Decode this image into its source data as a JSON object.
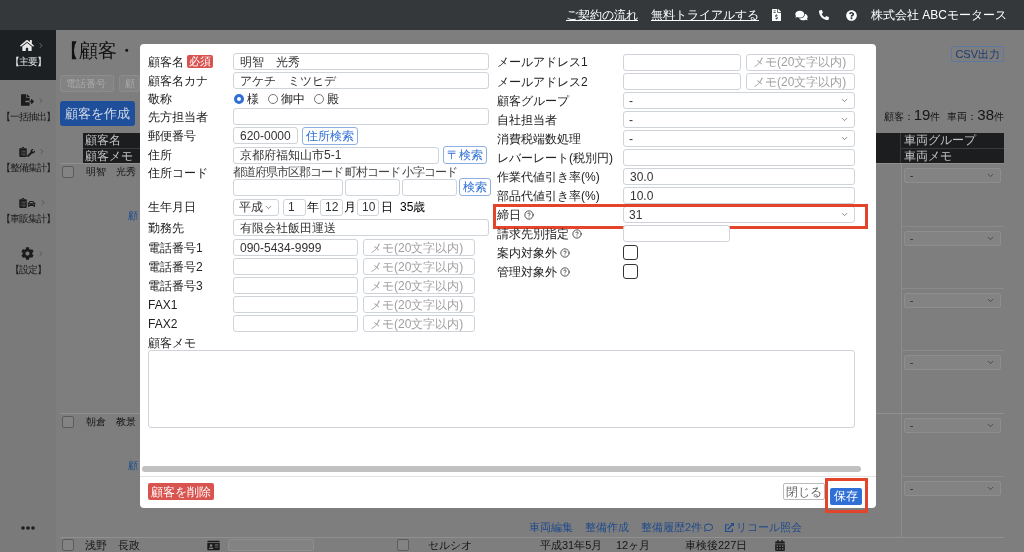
{
  "header": {
    "links": [
      "ご契約の流れ",
      "無料トライアルする"
    ],
    "company": "株式会社 ABCモータース"
  },
  "sidebar": {
    "items": [
      {
        "label": "【主要】",
        "selected": true
      },
      {
        "label": "【一括抽出】",
        "selected": false
      },
      {
        "label": "【整備集計】",
        "selected": false
      },
      {
        "label": "【車販集計】",
        "selected": false
      },
      {
        "label": "【設定】",
        "selected": false
      }
    ]
  },
  "page": {
    "title": "【顧客・",
    "filters": [
      {
        "placeholder": "電話番号"
      },
      {
        "placeholder": "顧"
      }
    ],
    "create_button": "顧客を作成",
    "csv_button": "CSV出力",
    "counts": [
      {
        "label": "顧客：",
        "value": "19",
        "unit": "件"
      },
      {
        "label": "車両：",
        "value": "38",
        "unit": "件"
      }
    ]
  },
  "table": {
    "left_header": [
      "顧客名",
      "顧客メモ"
    ],
    "right_header": [
      "車両グループ",
      "車両メモ"
    ],
    "rows": [
      {
        "checked": false,
        "name": "明智　光秀",
        "link": "顧",
        "vehicles": [
          {
            "group": "-"
          },
          {
            "group": "-"
          },
          {
            "group": "-"
          },
          {
            "group": "-"
          }
        ]
      },
      {
        "checked": false,
        "name": "朝倉　教景",
        "link": "顧",
        "vehicles": [
          {
            "group": "-"
          },
          {
            "group": "-"
          }
        ],
        "actions": [
          {
            "kind": "plain",
            "label": "車両編集"
          },
          {
            "kind": "plain",
            "label": "整備作成"
          },
          {
            "kind": "comments",
            "label": "整備履歴2件"
          },
          {
            "kind": "external",
            "label": "リコール照会"
          }
        ]
      },
      {
        "checked": false,
        "name": "浅野　長政",
        "vehicle": {
          "checked": false,
          "model": "セルシオ",
          "first_registered": "平成31年5月",
          "interval": "12ヶ月",
          "inspection": "車検後227日"
        }
      }
    ]
  },
  "modal": {
    "left_fields": [
      {
        "kind": "text",
        "label": "顧客名",
        "badge": "必須",
        "value": "明智　光秀"
      },
      {
        "kind": "text",
        "label": "顧客名カナ",
        "value": "アケチ　ミツヒデ"
      },
      {
        "kind": "radio",
        "label": "敬称",
        "options": [
          {
            "label": "様",
            "selected": true
          },
          {
            "label": "御中",
            "selected": false
          },
          {
            "label": "殿",
            "selected": false
          }
        ]
      },
      {
        "kind": "text",
        "label": "先方担当者"
      },
      {
        "kind": "postcode",
        "label": "郵便番号",
        "value": "620-0000",
        "button": "住所検索"
      },
      {
        "kind": "address",
        "label": "住所",
        "value": "京都府福知山市5-1",
        "button": "〒検索"
      },
      {
        "kind": "codes",
        "label": "住所コード",
        "parts": [
          "都道府県市区郡コード",
          "町村コード",
          "小字コード"
        ],
        "button": "検索"
      },
      {
        "kind": "date",
        "label": "生年月日",
        "era": "平成",
        "year": "1",
        "year_unit": "年",
        "month": "12",
        "month_unit": "月",
        "day": "10",
        "day_unit": "日",
        "age": "35歳"
      },
      {
        "kind": "text",
        "label": "勤務先",
        "value": "有限会社飯田運送"
      },
      {
        "kind": "text_memo",
        "label": "電話番号1",
        "value": "090-5434-9999",
        "memo_placeholder": "メモ(20文字以内)"
      },
      {
        "kind": "text_memo",
        "label": "電話番号2",
        "memo_placeholder": "メモ(20文字以内)"
      },
      {
        "kind": "text_memo",
        "label": "電話番号3",
        "memo_placeholder": "メモ(20文字以内)"
      },
      {
        "kind": "text_memo",
        "label": "FAX1",
        "memo_placeholder": "メモ(20文字以内)"
      },
      {
        "kind": "text_memo",
        "label": "FAX2",
        "memo_placeholder": "メモ(20文字以内)"
      }
    ],
    "right_fields": [
      {
        "kind": "text_memo",
        "label": "メールアドレス1",
        "memo_placeholder": "メモ(20文字以内)",
        "help": false,
        "highlighted": false
      },
      {
        "kind": "text_memo",
        "label": "メールアドレス2",
        "memo_placeholder": "メモ(20文字以内)",
        "help": false,
        "highlighted": false
      },
      {
        "kind": "select",
        "label": "顧客グループ",
        "value": "-",
        "help": false,
        "highlighted": false
      },
      {
        "kind": "select",
        "label": "自社担当者",
        "value": "-",
        "help": false,
        "highlighted": false
      },
      {
        "kind": "select",
        "label": "消費税端数処理",
        "value": "-",
        "help": false,
        "highlighted": false
      },
      {
        "kind": "text",
        "label": "レバーレート(税別円)",
        "help": false,
        "highlighted": false
      },
      {
        "kind": "text",
        "label": "作業代値引き率(%)",
        "value": "30.0",
        "help": false,
        "highlighted": false
      },
      {
        "kind": "text",
        "label": "部品代値引き率(%)",
        "value": "10.0",
        "help": false,
        "highlighted": false
      },
      {
        "kind": "select",
        "label": "締日",
        "value": "31",
        "help": true,
        "highlighted": true
      },
      {
        "kind": "short",
        "label": "請求先別指定",
        "help": true,
        "highlighted": false
      },
      {
        "kind": "checkbox",
        "label": "案内対象外",
        "checked": false,
        "help": true,
        "highlighted": false
      },
      {
        "kind": "checkbox",
        "label": "管理対象外",
        "checked": false,
        "help": true,
        "highlighted": false
      }
    ],
    "memo": {
      "label": "顧客メモ"
    },
    "footer": {
      "delete_button": "顧客を削除",
      "close_button": "閉じる",
      "save_button": {
        "label": "保存",
        "highlighted": true
      }
    }
  }
}
